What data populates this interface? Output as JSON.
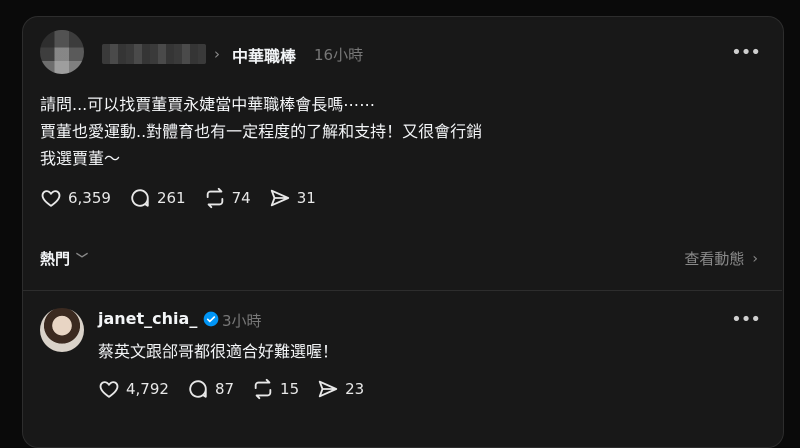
{
  "post": {
    "community": "中華職棒",
    "time": "16小時",
    "lines": [
      "請問...可以找賈董賈永婕當中華職棒會長嗎⋯⋯",
      "賈董也愛運動..對體育也有一定程度的了解和支持！又很會行銷",
      "我選賈董～"
    ],
    "likes": "6,359",
    "comments": "261",
    "reposts": "74",
    "shares": "31"
  },
  "sort": {
    "label": "熱門",
    "view_activity": "查看動態"
  },
  "reply": {
    "username": "janet_chia_",
    "time": "3小時",
    "text": "蔡英文跟郃哥都很適合好難選喔！",
    "likes": "4,792",
    "comments": "87",
    "reposts": "15",
    "shares": "23"
  },
  "colors": {
    "background": "#0a0a0a",
    "card": "#181818",
    "verified": "#0095f6"
  }
}
